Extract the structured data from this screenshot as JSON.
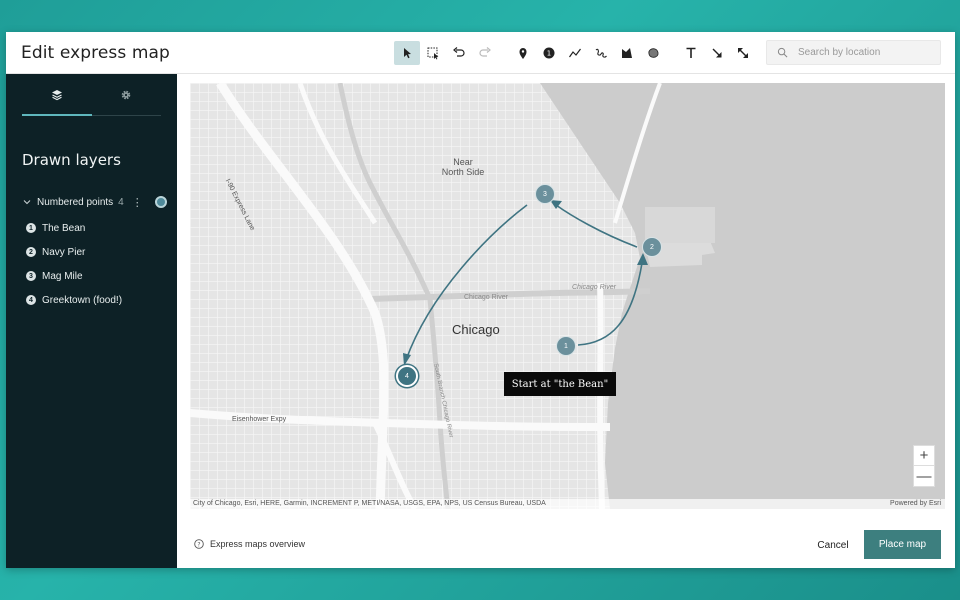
{
  "header": {
    "title": "Edit express map",
    "search_placeholder": "Search by location",
    "tools": [
      "select-tool",
      "marquee-select-tool",
      "undo",
      "redo",
      "pin-tool",
      "numbered-point-tool",
      "line-tool",
      "freehand-tool",
      "area-tool",
      "blob-tool",
      "text-tool",
      "arrow-tool",
      "double-arrow-tool"
    ]
  },
  "sidebar": {
    "tabs": [
      "layers-icon",
      "gear-icon"
    ],
    "title": "Drawn layers",
    "group": {
      "label": "Numbered points",
      "count": "4"
    },
    "items": [
      {
        "num": "1",
        "label": "The Bean"
      },
      {
        "num": "2",
        "label": "Navy Pier"
      },
      {
        "num": "3",
        "label": "Mag Mile"
      },
      {
        "num": "4",
        "label": "Greektown (food!)"
      }
    ]
  },
  "map": {
    "labels": {
      "near_north": "Near\nNorth Side",
      "chicago": "Chicago",
      "expressway": "I-90 Express Lane",
      "eisenhower": "Eisenhower Expy",
      "river1": "Chicago River",
      "river2": "Chicago River",
      "south_branch": "South Branch Chicago River"
    },
    "pins": [
      "1",
      "2",
      "3",
      "4"
    ],
    "tooltip": "Start at \"the Bean\"",
    "attribution": "City of Chicago, Esri, HERE, Garmin, INCREMENT P, METI/NASA, USGS, EPA, NPS, US Census Bureau, USDA",
    "powered_by": "Powered by Esri",
    "zoom_in": "+",
    "zoom_out": "—"
  },
  "footer": {
    "overview": "Express maps overview",
    "cancel": "Cancel",
    "place": "Place map"
  },
  "colors": {
    "accent": "#3d7f7f",
    "sidebar": "#0d2126",
    "route": "#3f7482",
    "water": "#cccccc"
  }
}
